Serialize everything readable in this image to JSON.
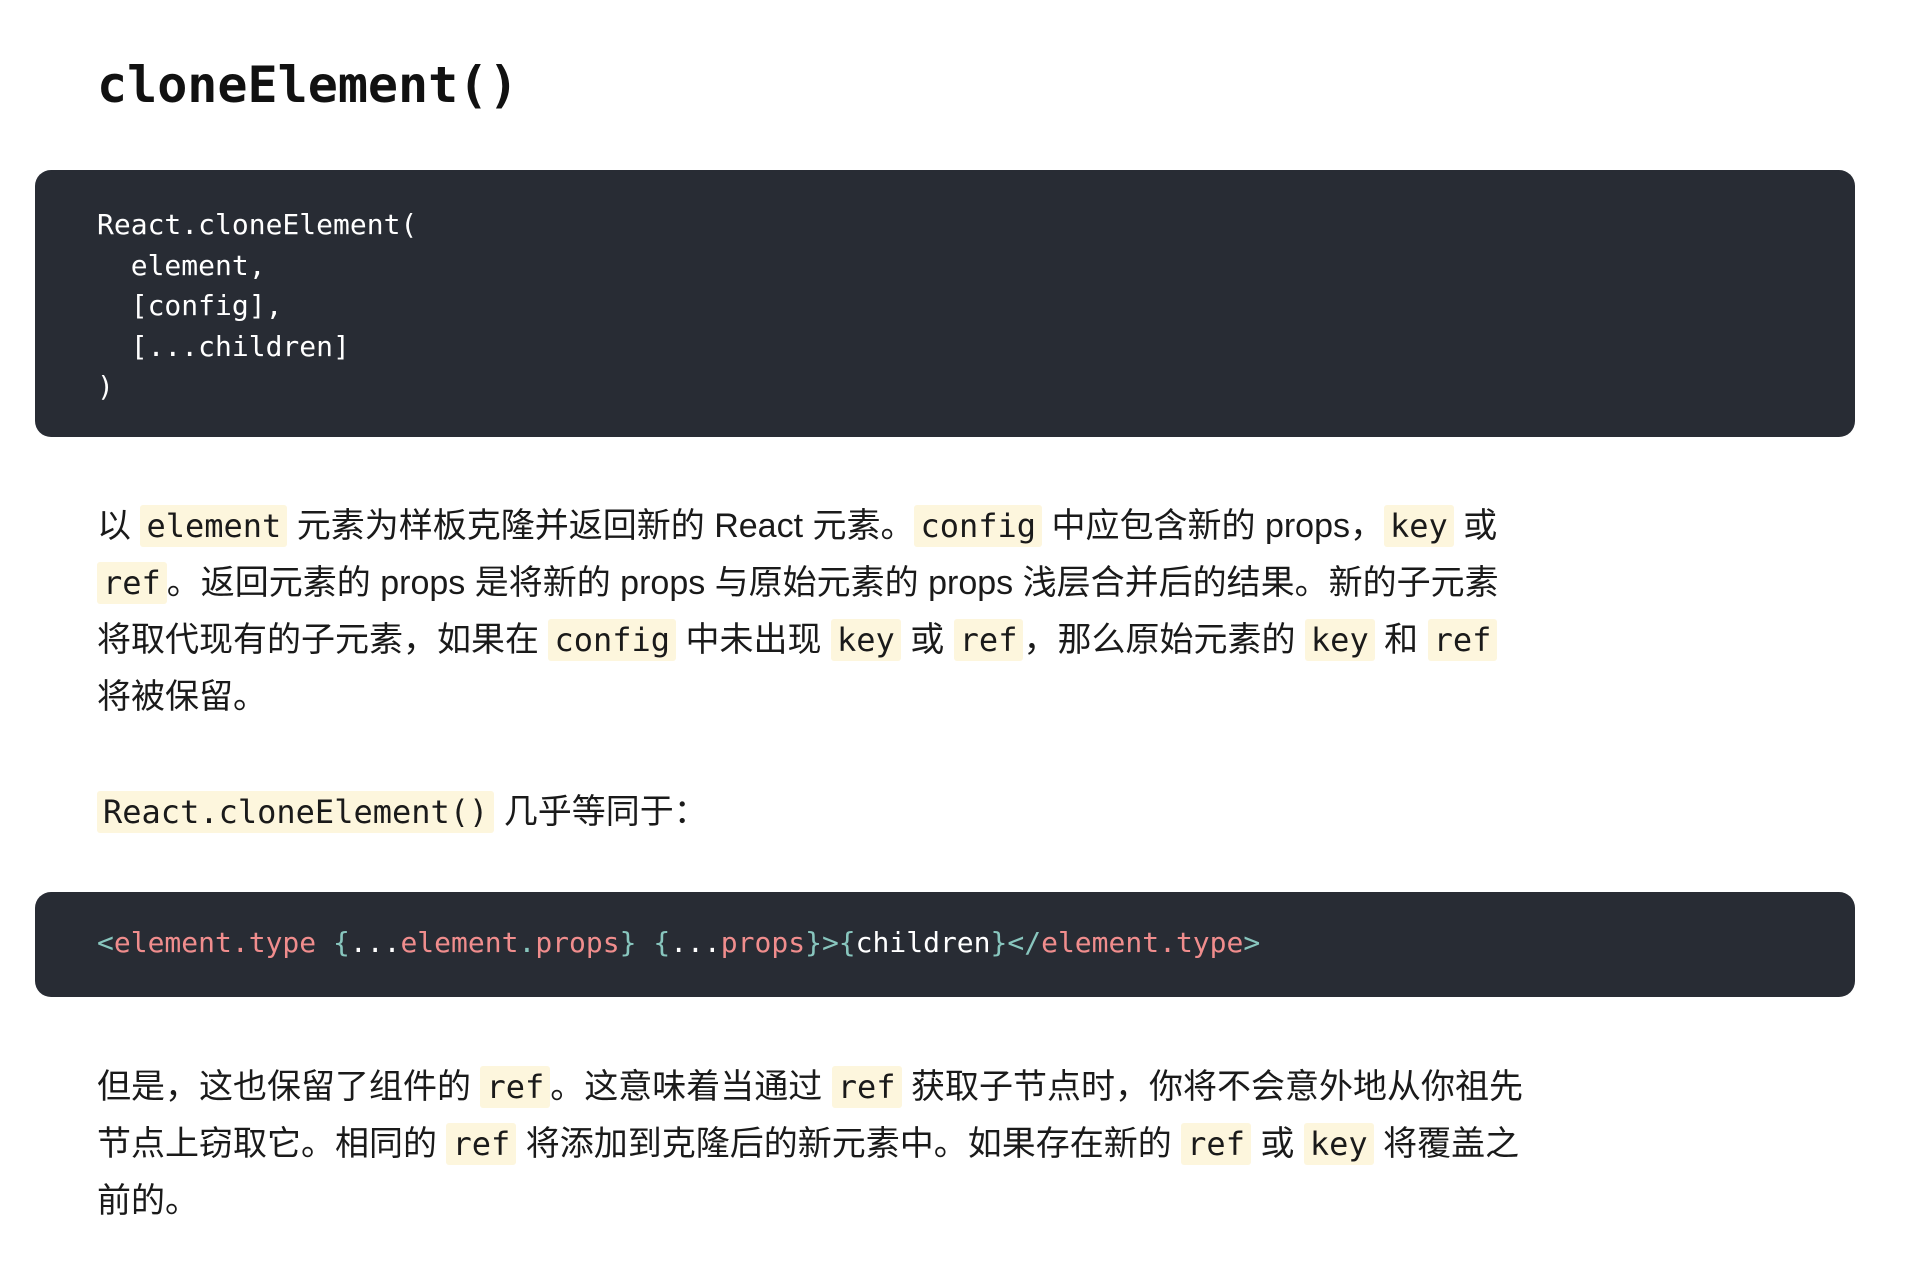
{
  "heading": {
    "title": "cloneElement()"
  },
  "signature_code": {
    "lines": [
      "React.cloneElement(",
      "  element,",
      "  [config],",
      "  [...children]",
      ")"
    ]
  },
  "paragraph1": {
    "l1_t1": "以 ",
    "l1_c1": "element",
    "l1_t2": " 元素为样板克隆并返回新的 React 元素。",
    "l1_c2": "config",
    "l1_t3": " 中应包含新的 props，",
    "l1_c3": "key",
    "l1_t4": " 或",
    "l2_c1": "ref",
    "l2_t1": "。返回元素的 props 是将新的 props 与原始元素的 props 浅层合并后的结果。新的子元素",
    "l3_t1": "将取代现有的子元素，如果在 ",
    "l3_c1": "config",
    "l3_t2": " 中未出现 ",
    "l3_c2": "key",
    "l3_t3": " 或 ",
    "l3_c3": "ref",
    "l3_t4": "，那么原始元素的 ",
    "l3_c4": "key",
    "l3_t5": " 和 ",
    "l3_c5": "ref",
    "l4_t1": "将被保留。"
  },
  "paragraph2": {
    "c1": "React.cloneElement()",
    "t1": " 几乎等同于："
  },
  "equivalent_code": {
    "lt": "<",
    "tag": "element.type",
    "sp1": " ",
    "ob1": "{",
    "spread1": "...",
    "obj1": "element",
    "dot1": ".",
    "prop1": "props",
    "cb1": "}",
    "sp2": " ",
    "ob2": "{",
    "spread2": "...",
    "prop2": "props",
    "cb2": "}",
    "gt": ">",
    "ob3": "{",
    "children": "children",
    "cb3": "}",
    "close_lt": "</",
    "close_tag": "element.type",
    "close_gt": ">"
  },
  "paragraph3": {
    "l1_t1": "但是，这也保留了组件的 ",
    "l1_c1": "ref",
    "l1_t2": "。这意味着当通过 ",
    "l1_c2": "ref",
    "l1_t3": " 获取子节点时，你将不会意外地从你祖先",
    "l2_t1": "节点上窃取它。相同的 ",
    "l2_c1": "ref",
    "l2_t2": " 将添加到克隆后的新元素中。如果存在新的 ",
    "l2_c2": "ref",
    "l2_t3": " 或 ",
    "l2_c3": "key",
    "l2_t4": " 将覆盖之",
    "l3_t1": "前的。"
  }
}
